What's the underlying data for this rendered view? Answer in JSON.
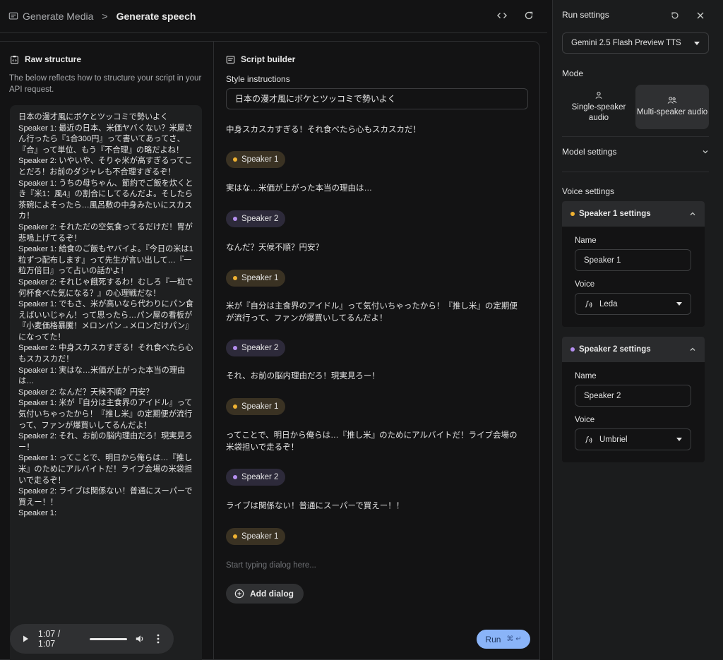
{
  "header": {
    "crumb_parent": "Generate Media",
    "crumb_separator": ">",
    "crumb_current": "Generate speech"
  },
  "raw_structure": {
    "title": "Raw structure",
    "description": "The below reflects how to structure your script in your API request.",
    "content": "日本の漫才風にボケとツッコミで勢いよく\nSpeaker 1: 最近の日本、米価ヤバくない？米屋さん行ったら『1合300円』って書いてあってさ、『合』って単位、もう『不合理』の略だよね！\nSpeaker 2: いやいや、そりゃ米が高すぎるってことだろ！お前のダジャレも不合理すぎるぞ！\nSpeaker 1: うちの母ちゃん、節約でご飯を炊くとき『米1：風4』の割合にしてるんだよ。そしたら茶碗によそったら…風呂敷の中身みたいにスカスカ！\nSpeaker 2: それただの空気食ってるだけだ！胃が悲鳴上げてるぞ！\nSpeaker 1: 給食のご飯もヤバイよ。『今日の米は1粒ずつ配布します』って先生が言い出して…『一粒万倍日』って占いの話かよ！\nSpeaker 2: それじゃ餓死するわ！むしろ『一粒で何杯食べた気になる？』の心理戦だな！\nSpeaker 1: でもさ、米が高いなら代わりにパン食えばいいじゃん！って思ったら…パン屋の看板が『小麦価格暴騰！メロンパン→メロンだけパン』になってた！\nSpeaker 2: 中身スカスカすぎる！それ食べたら心もスカスカだ！\nSpeaker 1: 実はな…米価が上がった本当の理由は…\nSpeaker 2: なんだ？天候不順？円安？\nSpeaker 1: 米が『自分は主食界のアイドル』って気付いちゃったから！『推し米』の定期便が流行って、ファンが爆買いしてるんだよ！\nSpeaker 2: それ、お前の脳内理由だろ！現実見ろー！\nSpeaker 1: ってことで、明日から俺らは…『推し米』のためにアルバイトだ！ライブ会場の米袋担いで走るぞ！\nSpeaker 2: ライブは関係ない！普通にスーパーで買えー！！\nSpeaker 1:"
  },
  "script_builder": {
    "title": "Script builder",
    "style_label": "Style instructions",
    "style_value": "日本の漫才風にボケとツッコミで勢いよく",
    "items": [
      {
        "type": "text",
        "text": "中身スカスカすぎる！それ食べたら心もスカスカだ！"
      },
      {
        "type": "chip",
        "speaker": "Speaker 1"
      },
      {
        "type": "text",
        "text": "実はな…米価が上がった本当の理由は…"
      },
      {
        "type": "chip",
        "speaker": "Speaker 2"
      },
      {
        "type": "text",
        "text": "なんだ？天候不順？円安？"
      },
      {
        "type": "chip",
        "speaker": "Speaker 1"
      },
      {
        "type": "text",
        "text": "米が『自分は主食界のアイドル』って気付いちゃったから！『推し米』の定期便が流行って、ファンが爆買いしてるんだよ！"
      },
      {
        "type": "chip",
        "speaker": "Speaker 2"
      },
      {
        "type": "text",
        "text": "それ、お前の脳内理由だろ！現実見ろー！"
      },
      {
        "type": "chip",
        "speaker": "Speaker 1"
      },
      {
        "type": "text",
        "text": "ってことで、明日から俺らは…『推し米』のためにアルバイトだ！ライブ会場の米袋担いで走るぞ！"
      },
      {
        "type": "chip",
        "speaker": "Speaker 2"
      },
      {
        "type": "text",
        "text": "ライブは関係ない！普通にスーパーで買えー！！"
      },
      {
        "type": "chip",
        "speaker": "Speaker 1"
      }
    ],
    "dialog_placeholder": "Start typing dialog here...",
    "add_dialog_label": "Add dialog"
  },
  "player": {
    "time": "1:07 / 1:07",
    "progress": 1.0
  },
  "run_button": {
    "label": "Run",
    "shortcut": "⌘ ↵"
  },
  "run_settings": {
    "title": "Run settings",
    "model": "Gemini 2.5 Flash Preview TTS",
    "mode_label": "Mode",
    "mode_single": "Single-speaker audio",
    "mode_multi": "Multi-speaker audio",
    "selected_mode": "multi",
    "model_settings_label": "Model settings",
    "voice_settings_label": "Voice settings",
    "speaker1": {
      "header": "Speaker 1 settings",
      "name_label": "Name",
      "name_value": "Speaker 1",
      "voice_label": "Voice",
      "voice_value": "Leda"
    },
    "speaker2": {
      "header": "Speaker 2 settings",
      "name_label": "Name",
      "name_value": "Speaker 2",
      "voice_label": "Voice",
      "voice_value": "Umbriel"
    }
  },
  "colors": {
    "speaker1_dot": "#f0b232",
    "speaker2_dot": "#b48ef0",
    "run_button": "#8ab4f8"
  }
}
